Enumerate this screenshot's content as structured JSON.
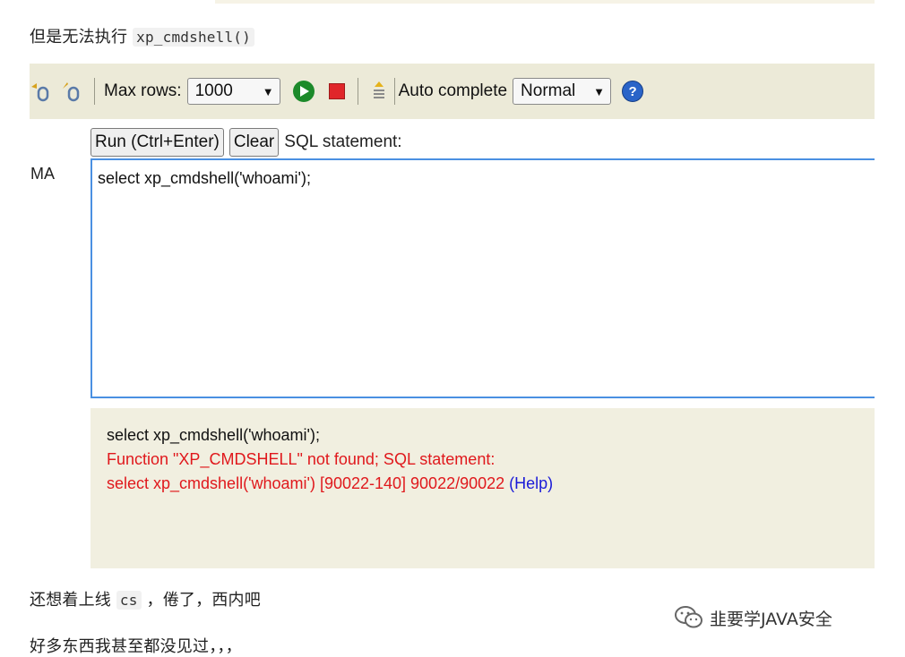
{
  "article": {
    "para1_text": "但是无法执行",
    "para1_code": "xp_cmdshell()",
    "para2_text_a": "还想着上线",
    "para2_code": "cs",
    "para2_text_b": "，倦了，西内吧",
    "para3_text": "好多东西我甚至都没见过，，，"
  },
  "toolbar": {
    "max_rows_label": "Max rows:",
    "max_rows_value": "1000",
    "auto_complete_label": "Auto complete",
    "auto_complete_value": "Normal",
    "help_glyph": "?"
  },
  "editor": {
    "left_label": "MA",
    "run_button": "Run (Ctrl+Enter)",
    "clear_button": "Clear",
    "sql_label": "SQL statement:",
    "sql_text": "select xp_cmdshell('whoami');"
  },
  "result": {
    "statement": "select xp_cmdshell('whoami');",
    "error_line1": "Function \"XP_CMDSHELL\" not found; SQL statement:",
    "error_line2": "select xp_cmdshell('whoami') [90022-140] 90022/90022",
    "help_link": "(Help)"
  },
  "watermark": {
    "text": "韭要学JAVA安全",
    "icon": "wechat-icon"
  },
  "colors": {
    "toolbar_bg": "#ecead8",
    "result_bg": "#f1efe0",
    "error": "#e0181c",
    "link": "#1a1ad8",
    "editor_border": "#4a90e2"
  }
}
